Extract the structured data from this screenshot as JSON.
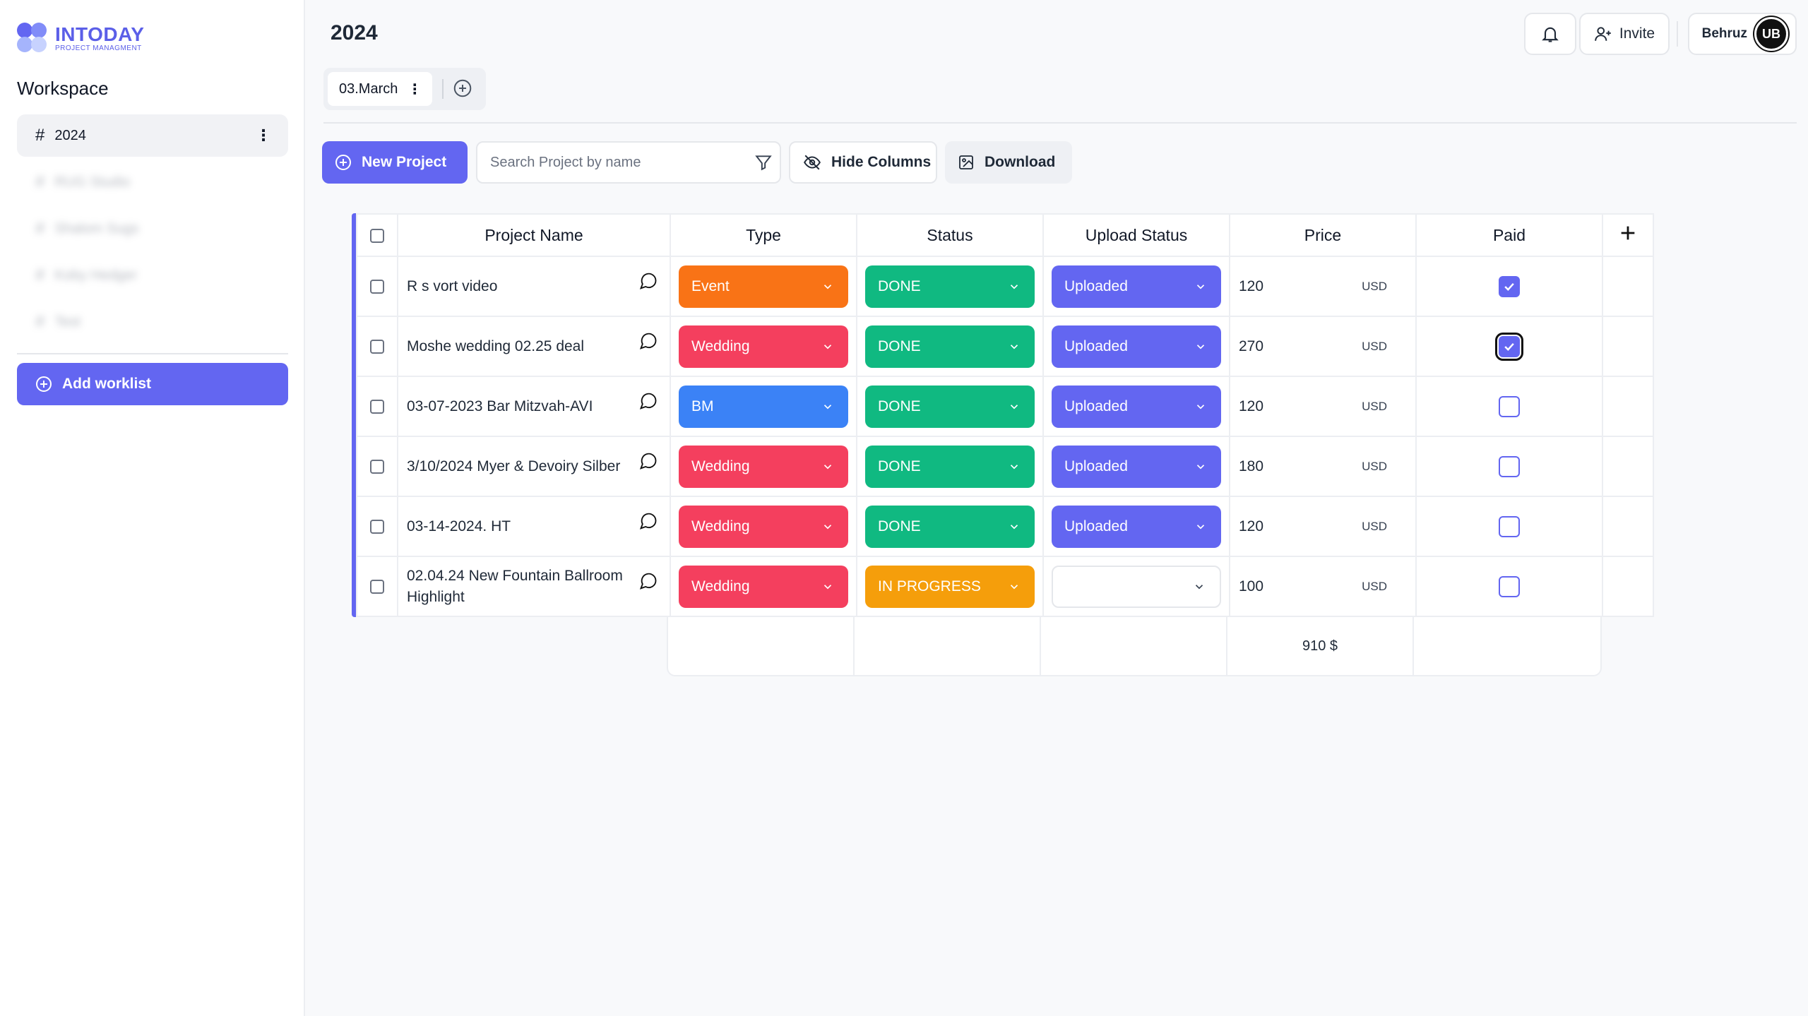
{
  "brand": {
    "name": "INTODAY",
    "tagline": "PROJECT MANAGMENT",
    "colors": [
      "#6366f1",
      "#818cf8",
      "#a5b4fc",
      "#c7d2fe"
    ]
  },
  "sidebar": {
    "title": "Workspace",
    "active_item": {
      "label": "2024"
    },
    "blurred_items": [
      "RUG Studio",
      "Shalom Sugs",
      "Koby Hedger",
      "Test"
    ],
    "add_worklist_label": "Add worklist"
  },
  "header": {
    "page_title": "2024",
    "invite_label": "Invite",
    "user_name": "Behruz",
    "avatar_initials": "UB"
  },
  "tabs": [
    {
      "label": "03.March"
    }
  ],
  "toolbar": {
    "new_project_label": "New Project",
    "search_placeholder": "Search Project by name",
    "hide_columns_label": "Hide Columns",
    "download_label": "Download"
  },
  "table": {
    "headers": {
      "name": "Project Name",
      "type": "Type",
      "status": "Status",
      "upload": "Upload Status",
      "price": "Price",
      "paid": "Paid"
    },
    "currency": "USD",
    "rows": [
      {
        "name": "R s vort video",
        "type": "Event",
        "type_color": "#f97316",
        "status": "DONE",
        "status_color": "#10b981",
        "upload": "Uploaded",
        "upload_color": "#6366f1",
        "price": "120",
        "paid": true,
        "focused": false
      },
      {
        "name": "Moshe wedding 02.25 deal",
        "type": "Wedding",
        "type_color": "#f43f5e",
        "status": "DONE",
        "status_color": "#10b981",
        "upload": "Uploaded",
        "upload_color": "#6366f1",
        "price": "270",
        "paid": true,
        "focused": true
      },
      {
        "name": "03-07-2023 Bar Mitzvah-AVI",
        "type": "BM",
        "type_color": "#3b82f6",
        "status": "DONE",
        "status_color": "#10b981",
        "upload": "Uploaded",
        "upload_color": "#6366f1",
        "price": "120",
        "paid": false,
        "focused": false
      },
      {
        "name": "3/10/2024 Myer & Devoiry Silber",
        "type": "Wedding",
        "type_color": "#f43f5e",
        "status": "DONE",
        "status_color": "#10b981",
        "upload": "Uploaded",
        "upload_color": "#6366f1",
        "price": "180",
        "paid": false,
        "focused": false
      },
      {
        "name": "03-14-2024. HT",
        "type": "Wedding",
        "type_color": "#f43f5e",
        "status": "DONE",
        "status_color": "#10b981",
        "upload": "Uploaded",
        "upload_color": "#6366f1",
        "price": "120",
        "paid": false,
        "focused": false
      },
      {
        "name": "02.04.24 New Fountain Ballroom Highlight",
        "type": "Wedding",
        "type_color": "#f43f5e",
        "status": "IN PROGRESS",
        "status_color": "#f59e0b",
        "upload": "",
        "upload_color": "",
        "price": "100",
        "paid": false,
        "focused": false
      }
    ],
    "total": "910 $"
  }
}
